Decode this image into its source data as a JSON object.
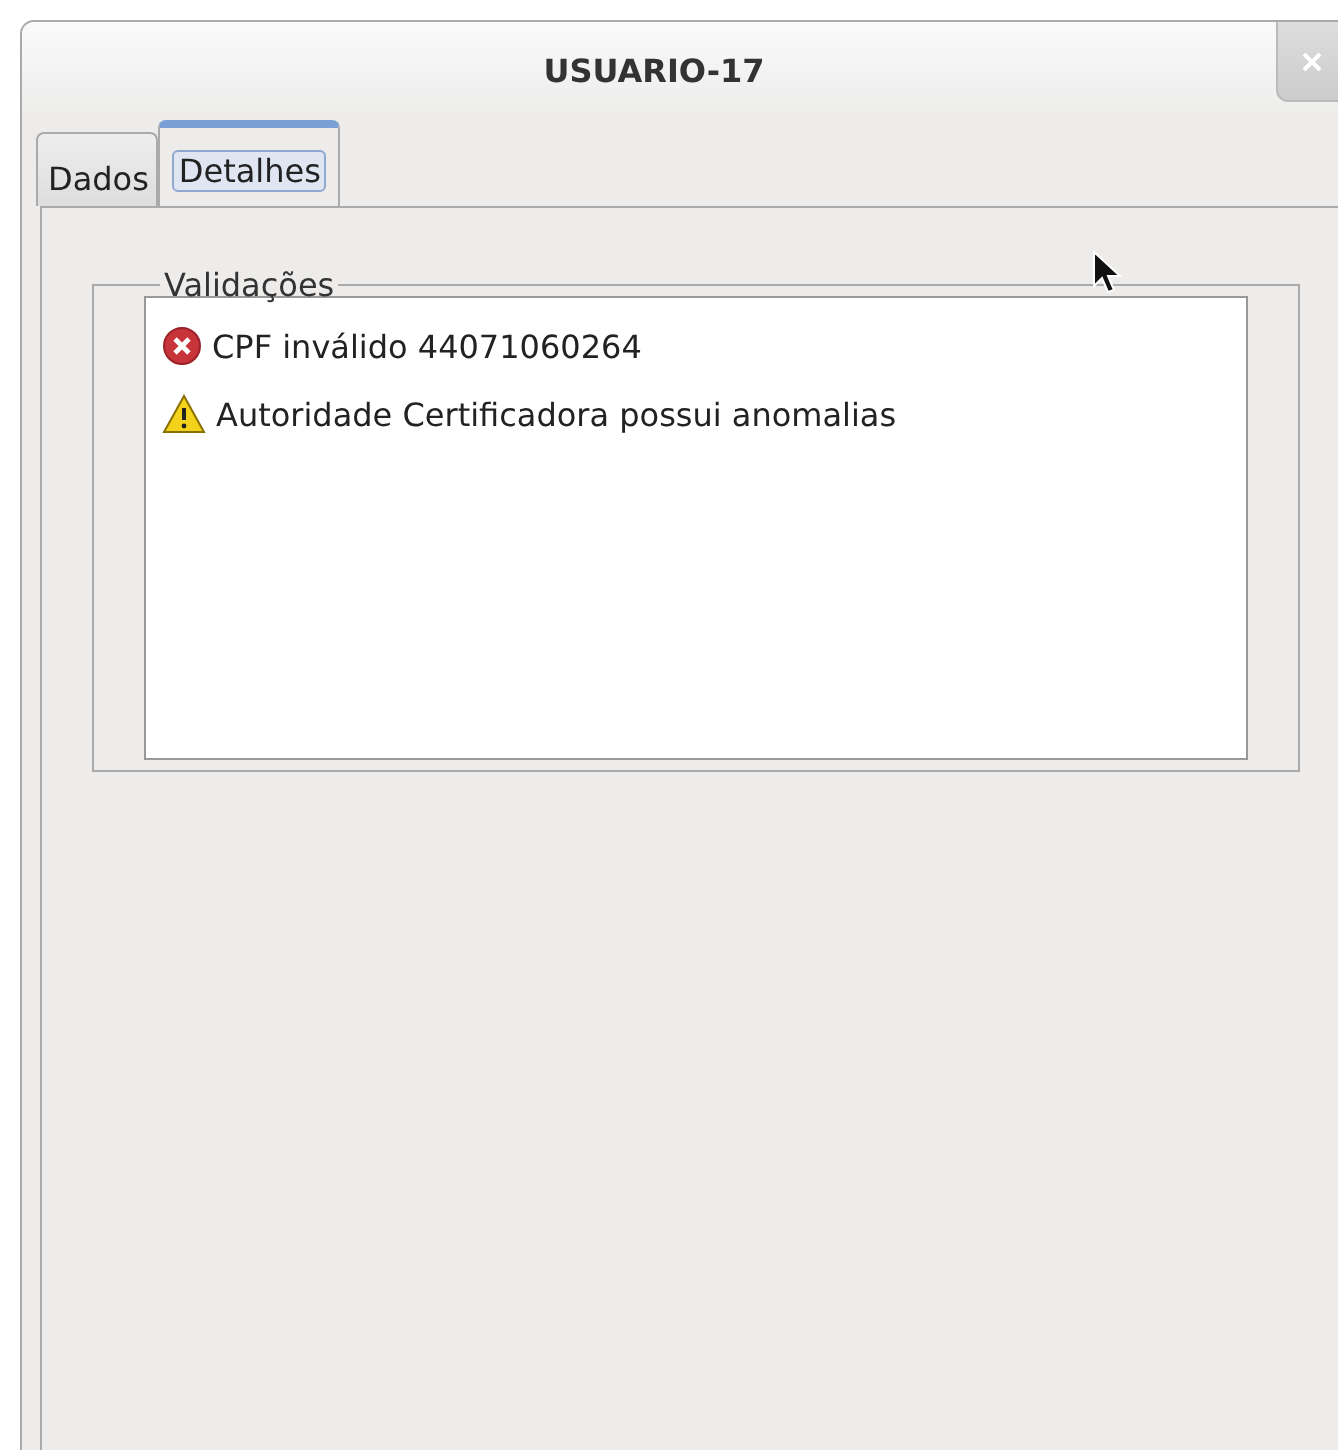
{
  "window": {
    "title": "USUARIO-17"
  },
  "tabs": [
    {
      "label": "Dados",
      "selected": false
    },
    {
      "label": "Detalhes",
      "selected": true
    }
  ],
  "group": {
    "title": "Validações",
    "items": [
      {
        "kind": "error",
        "text": "CPF inválido 44071060264"
      },
      {
        "kind": "warning",
        "text": "Autoridade Certificadora possui anomalias"
      }
    ]
  }
}
